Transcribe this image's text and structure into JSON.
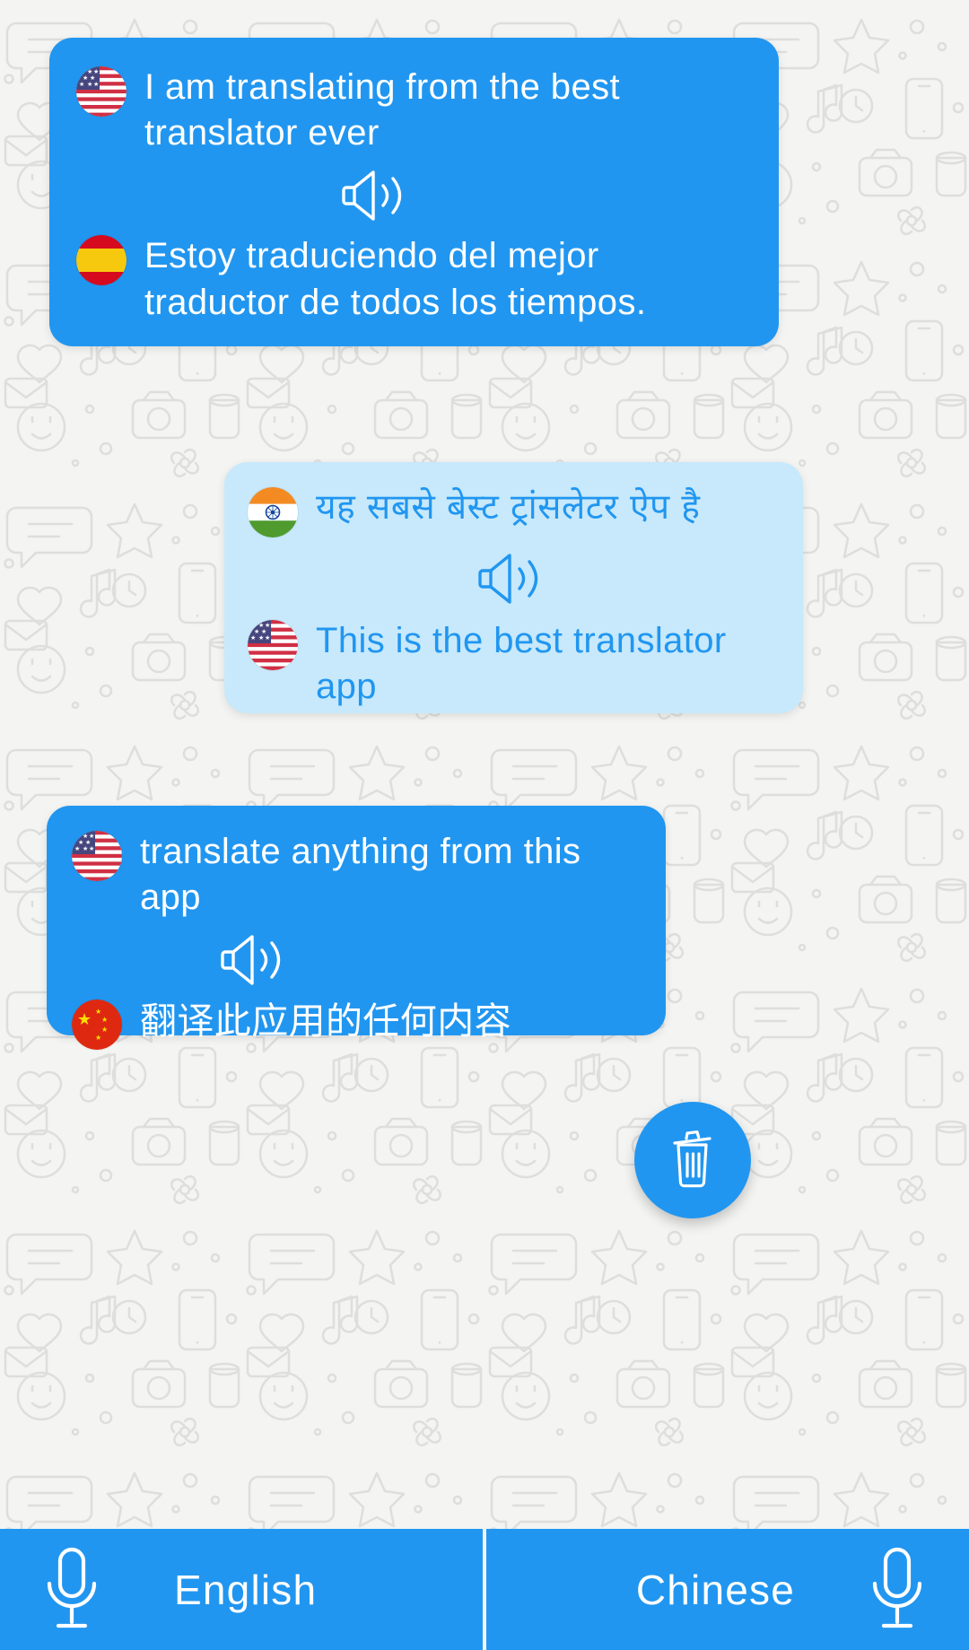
{
  "theme": {
    "primary_blue": "#2196f0",
    "incoming_blue": "#c7e9fb",
    "background": "#f4f4f2",
    "text_on_blue": "#ffffff"
  },
  "conversation": [
    {
      "id": "card-1",
      "direction": "outgoing",
      "source": {
        "flag": "us-flag-icon",
        "flag_label": "United States flag",
        "text": "I am translating from the best translator ever"
      },
      "speaker_icon": "speaker-icon",
      "target": {
        "flag": "es-flag-icon",
        "flag_label": "Spain flag",
        "text": "Estoy traduciendo del mejor traductor de todos los tiempos."
      }
    },
    {
      "id": "card-2",
      "direction": "incoming",
      "source": {
        "flag": "in-flag-icon",
        "flag_label": "India flag",
        "text": "यह सबसे बेस्ट ट्रांसलेटर ऐप है"
      },
      "speaker_icon": "speaker-icon",
      "target": {
        "flag": "us-flag-icon",
        "flag_label": "United States flag",
        "text": "This is the best translator app"
      }
    },
    {
      "id": "card-3",
      "direction": "outgoing",
      "source": {
        "flag": "us-flag-icon",
        "flag_label": "United States flag",
        "text": "translate anything from this app"
      },
      "speaker_icon": "speaker-icon",
      "target": {
        "flag": "cn-flag-icon",
        "flag_label": "China flag",
        "text": "翻译此应用的任何内容"
      }
    }
  ],
  "delete_button": {
    "icon": "trash-icon",
    "label": "Clear conversation"
  },
  "bottom_bar": {
    "left": {
      "label": "English",
      "icon": "microphone-icon"
    },
    "right": {
      "label": "Chinese",
      "icon": "microphone-icon"
    }
  }
}
